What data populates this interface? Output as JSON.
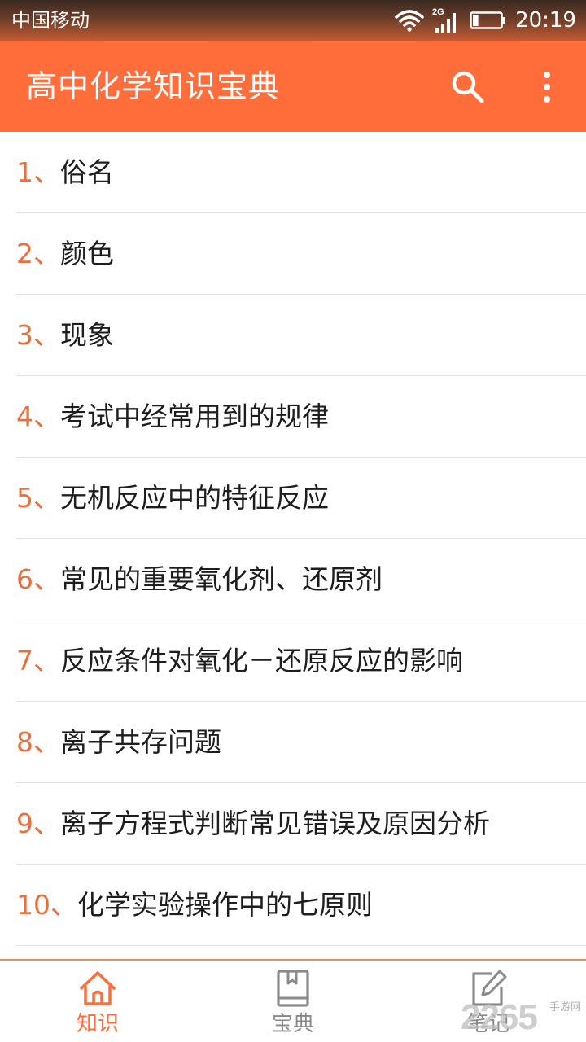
{
  "status_bar": {
    "carrier": "中国移动",
    "network_type": "2G",
    "battery_level": 0.2,
    "time": "20:19",
    "icons": [
      "wifi-icon",
      "signal-icon",
      "battery-icon"
    ]
  },
  "app_bar": {
    "title": "高中化学知识宝典",
    "search_icon": "search-icon",
    "more_icon": "more-vert-icon",
    "background_color": "#ff6d3a"
  },
  "list": {
    "items": [
      {
        "num": "1、",
        "text": "俗名"
      },
      {
        "num": "2、",
        "text": "颜色"
      },
      {
        "num": "3、",
        "text": "现象"
      },
      {
        "num": "4、",
        "text": "考试中经常用到的规律"
      },
      {
        "num": "5、",
        "text": "无机反应中的特征反应"
      },
      {
        "num": "6、",
        "text": "常见的重要氧化剂、还原剂"
      },
      {
        "num": "7、",
        "text": "反应条件对氧化－还原反应的影响"
      },
      {
        "num": "8、",
        "text": "离子共存问题"
      },
      {
        "num": "9、",
        "text": "离子方程式判断常见错误及原因分析"
      },
      {
        "num": "10、",
        "text": "化学实验操作中的七原则"
      }
    ],
    "number_color": "#e8703f"
  },
  "bottom_nav": {
    "tabs": [
      {
        "label": "知识",
        "icon": "home-icon",
        "active": true
      },
      {
        "label": "宝典",
        "icon": "book-icon",
        "active": false
      },
      {
        "label": "笔记",
        "icon": "edit-note-icon",
        "active": false
      }
    ],
    "active_color": "#ff6d3a",
    "inactive_color": "#888888"
  },
  "watermark": {
    "text": "2265",
    "sub_text": "手游网"
  }
}
